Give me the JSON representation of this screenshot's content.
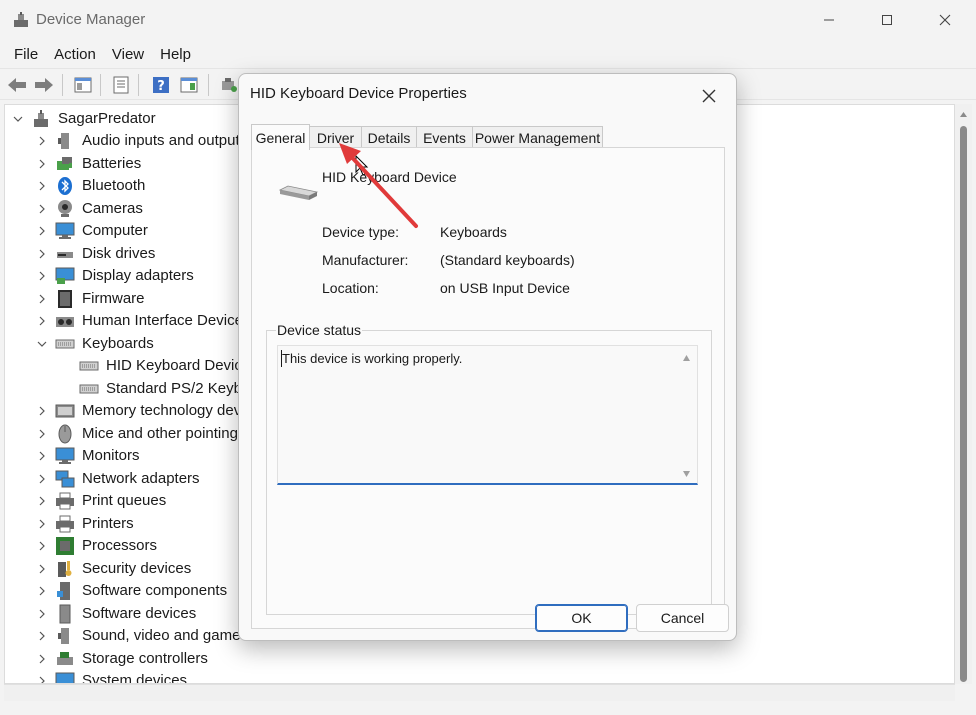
{
  "window": {
    "title": "Device Manager"
  },
  "menu": [
    "File",
    "Action",
    "View",
    "Help"
  ],
  "tree": {
    "root": "SagarPredator",
    "categories": [
      "Audio inputs and outputs",
      "Batteries",
      "Bluetooth",
      "Cameras",
      "Computer",
      "Disk drives",
      "Display adapters",
      "Firmware",
      "Human Interface Devices",
      "Keyboards",
      "Memory technology devices",
      "Mice and other pointing devices",
      "Monitors",
      "Network adapters",
      "Print queues",
      "Printers",
      "Processors",
      "Security devices",
      "Software components",
      "Software devices",
      "Sound, video and game controllers",
      "Storage controllers",
      "System devices"
    ],
    "keyboard_children": [
      "HID Keyboard Device",
      "Standard PS/2 Keyboard"
    ]
  },
  "dialog": {
    "title": "HID Keyboard Device Properties",
    "tabs": [
      "General",
      "Driver",
      "Details",
      "Events",
      "Power Management"
    ],
    "active_tab": "General",
    "device_name": "HID Keyboard Device",
    "properties": [
      {
        "label": "Device type:",
        "value": "Keyboards"
      },
      {
        "label": "Manufacturer:",
        "value": "(Standard keyboards)"
      },
      {
        "label": "Location:",
        "value": "on USB Input Device"
      }
    ],
    "status_group": "Device status",
    "status_text": "This device is working properly.",
    "ok": "OK",
    "cancel": "Cancel"
  },
  "colors": {
    "accent": "#2f6dbf",
    "arrow": "#e03a3a"
  }
}
